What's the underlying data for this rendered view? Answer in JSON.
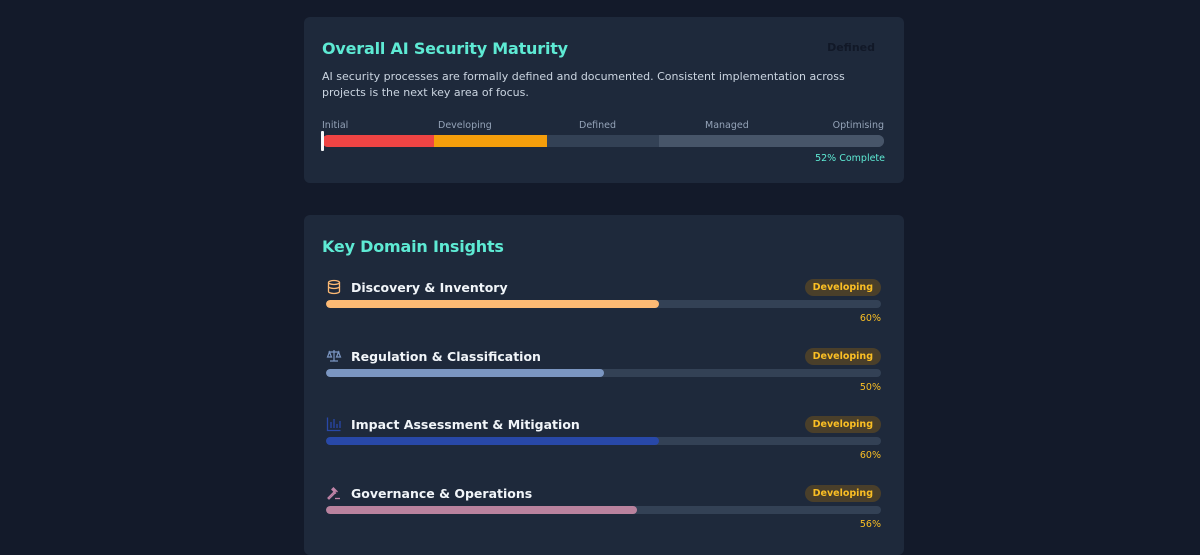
{
  "maturity": {
    "title": "Overall AI Security Maturity",
    "level": "Defined",
    "description": "AI security processes are formally defined and documented. Consistent implementation across projects is the next key area of focus.",
    "stages": [
      "Initial",
      "Developing",
      "Defined",
      "Managed",
      "Optimising"
    ],
    "stage_colors": [
      "#ef4444",
      "#f59e0b",
      "#334155",
      "#475569"
    ],
    "progress_fraction": 0.52,
    "complete_label": "52% Complete"
  },
  "insights": {
    "title": "Key Domain Insights",
    "domains": [
      {
        "name": "Discovery & Inventory",
        "badge": "Developing",
        "percent_label": "60%",
        "fraction": 0.6,
        "color": "#fdba74",
        "icon": "database-icon",
        "icon_color": "#fdba74"
      },
      {
        "name": "Regulation & Classification",
        "badge": "Developing",
        "percent_label": "50%",
        "fraction": 0.5,
        "color": "#7b96c2",
        "icon": "scale-icon",
        "icon_color": "#7b96c2"
      },
      {
        "name": "Impact Assessment & Mitigation",
        "badge": "Developing",
        "percent_label": "60%",
        "fraction": 0.6,
        "color": "#2848a8",
        "icon": "bar-chart-icon",
        "icon_color": "#2848a8"
      },
      {
        "name": "Governance & Operations",
        "badge": "Developing",
        "percent_label": "56%",
        "fraction": 0.56,
        "color": "#b9829e",
        "icon": "gavel-icon",
        "icon_color": "#c084a8"
      }
    ]
  }
}
